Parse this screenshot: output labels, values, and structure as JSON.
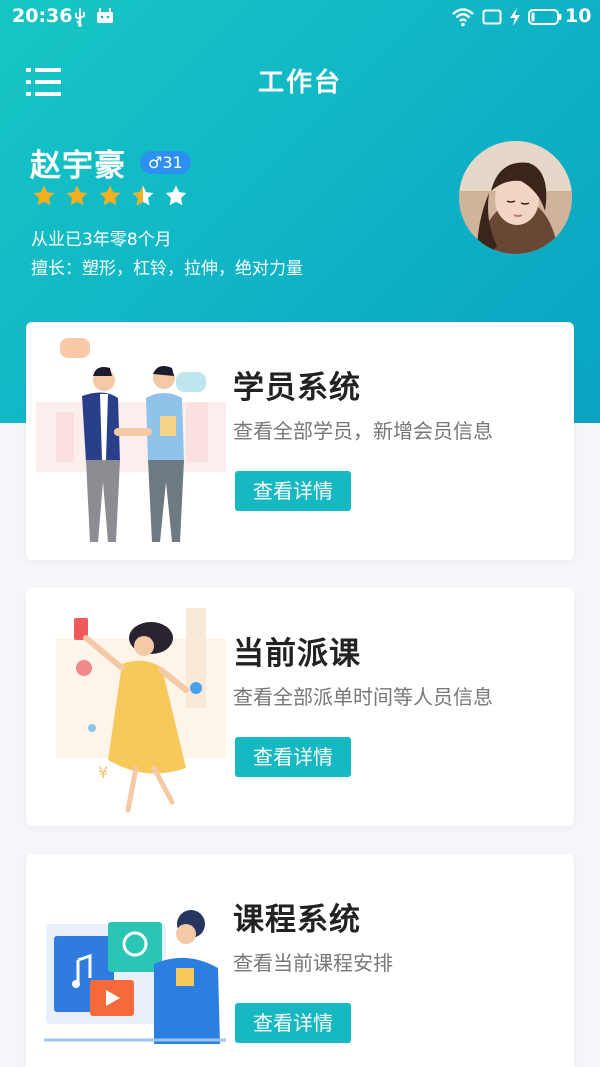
{
  "status_bar": {
    "time": "20:36",
    "battery_level": "10"
  },
  "header": {
    "title": "工作台"
  },
  "profile": {
    "name": "赵宇豪",
    "gender_age": "♂31",
    "rating": 3.5,
    "rating_max": 5,
    "experience": "从业已3年零8个月",
    "specialty": "擅长：塑形，杠铃，拉伸，绝对力量"
  },
  "cards": [
    {
      "title": "学员系统",
      "description": "查看全部学员，新增会员信息",
      "button": "查看详情"
    },
    {
      "title": "当前派课",
      "description": "查看全部派单时间等人员信息",
      "button": "查看详情"
    },
    {
      "title": "课程系统",
      "description": "查看当前课程安排",
      "button": "查看详情"
    }
  ],
  "colors": {
    "header_start": "#17c6c4",
    "header_end": "#0aa3c2",
    "accent": "#16b9c1",
    "star": "#f5b022",
    "star_empty": "#ffffff",
    "badge": "#2d8ff0"
  }
}
